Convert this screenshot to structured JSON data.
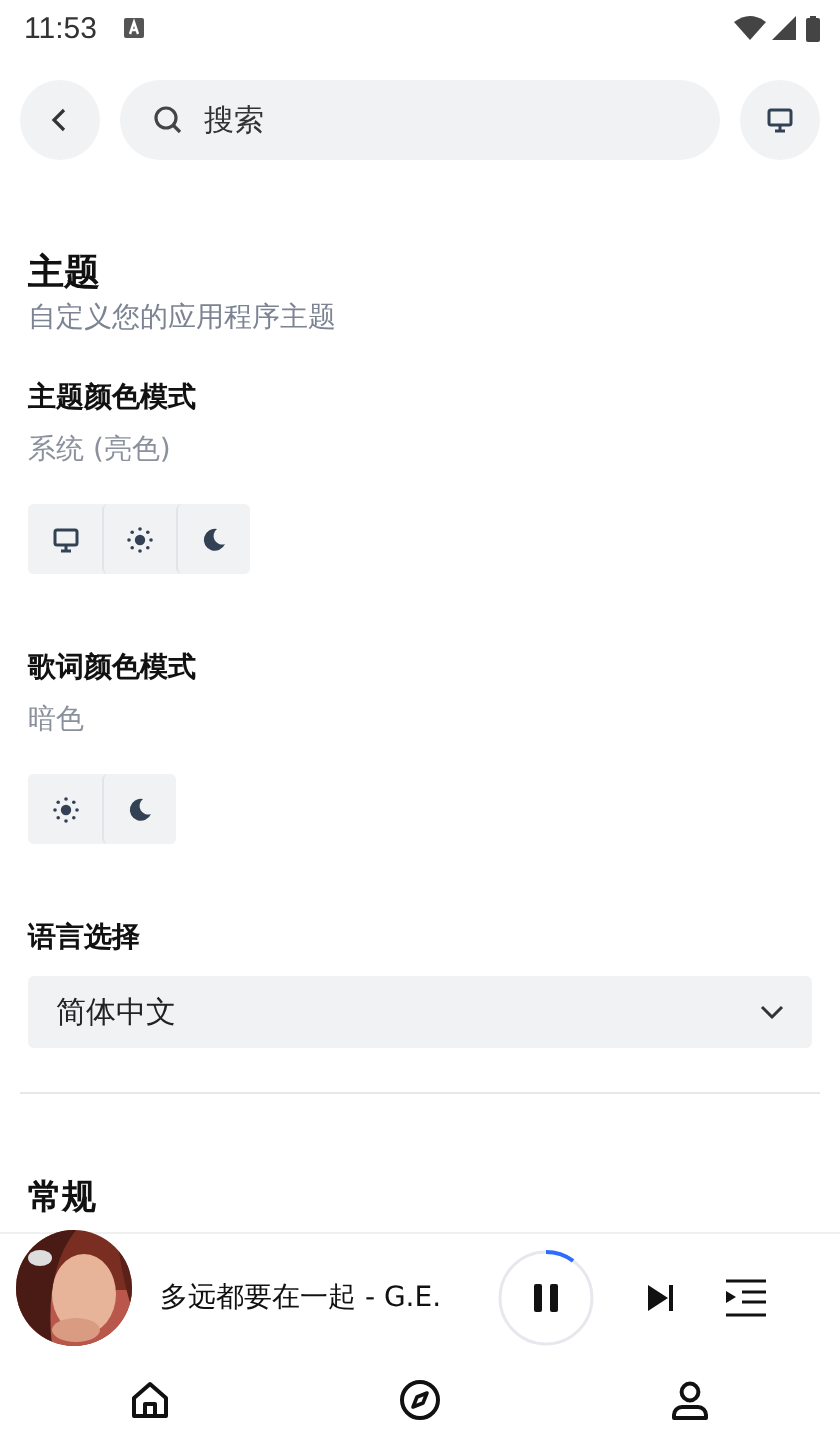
{
  "status_bar": {
    "time": "11:53"
  },
  "search": {
    "placeholder": "搜索"
  },
  "section": {
    "title": "主题",
    "subtitle": "自定义您的应用程序主题"
  },
  "settings": [
    {
      "label": "主题颜色模式",
      "value": "系统 (亮色)",
      "options": [
        {
          "kind": "monitor"
        },
        {
          "kind": "sun"
        },
        {
          "kind": "moon"
        }
      ]
    },
    {
      "label": "歌词颜色模式",
      "value": "暗色",
      "options": [
        {
          "kind": "sun"
        },
        {
          "kind": "moon"
        }
      ]
    }
  ],
  "language": {
    "label": "语言选择",
    "value": "简体中文"
  },
  "next_section": {
    "title": "常规"
  },
  "player": {
    "title": "多远都要在一起 - G.E.",
    "playing": true,
    "level": 0.1
  },
  "nav": [
    {
      "kind": "home"
    },
    {
      "kind": "compass"
    },
    {
      "kind": "user"
    }
  ]
}
